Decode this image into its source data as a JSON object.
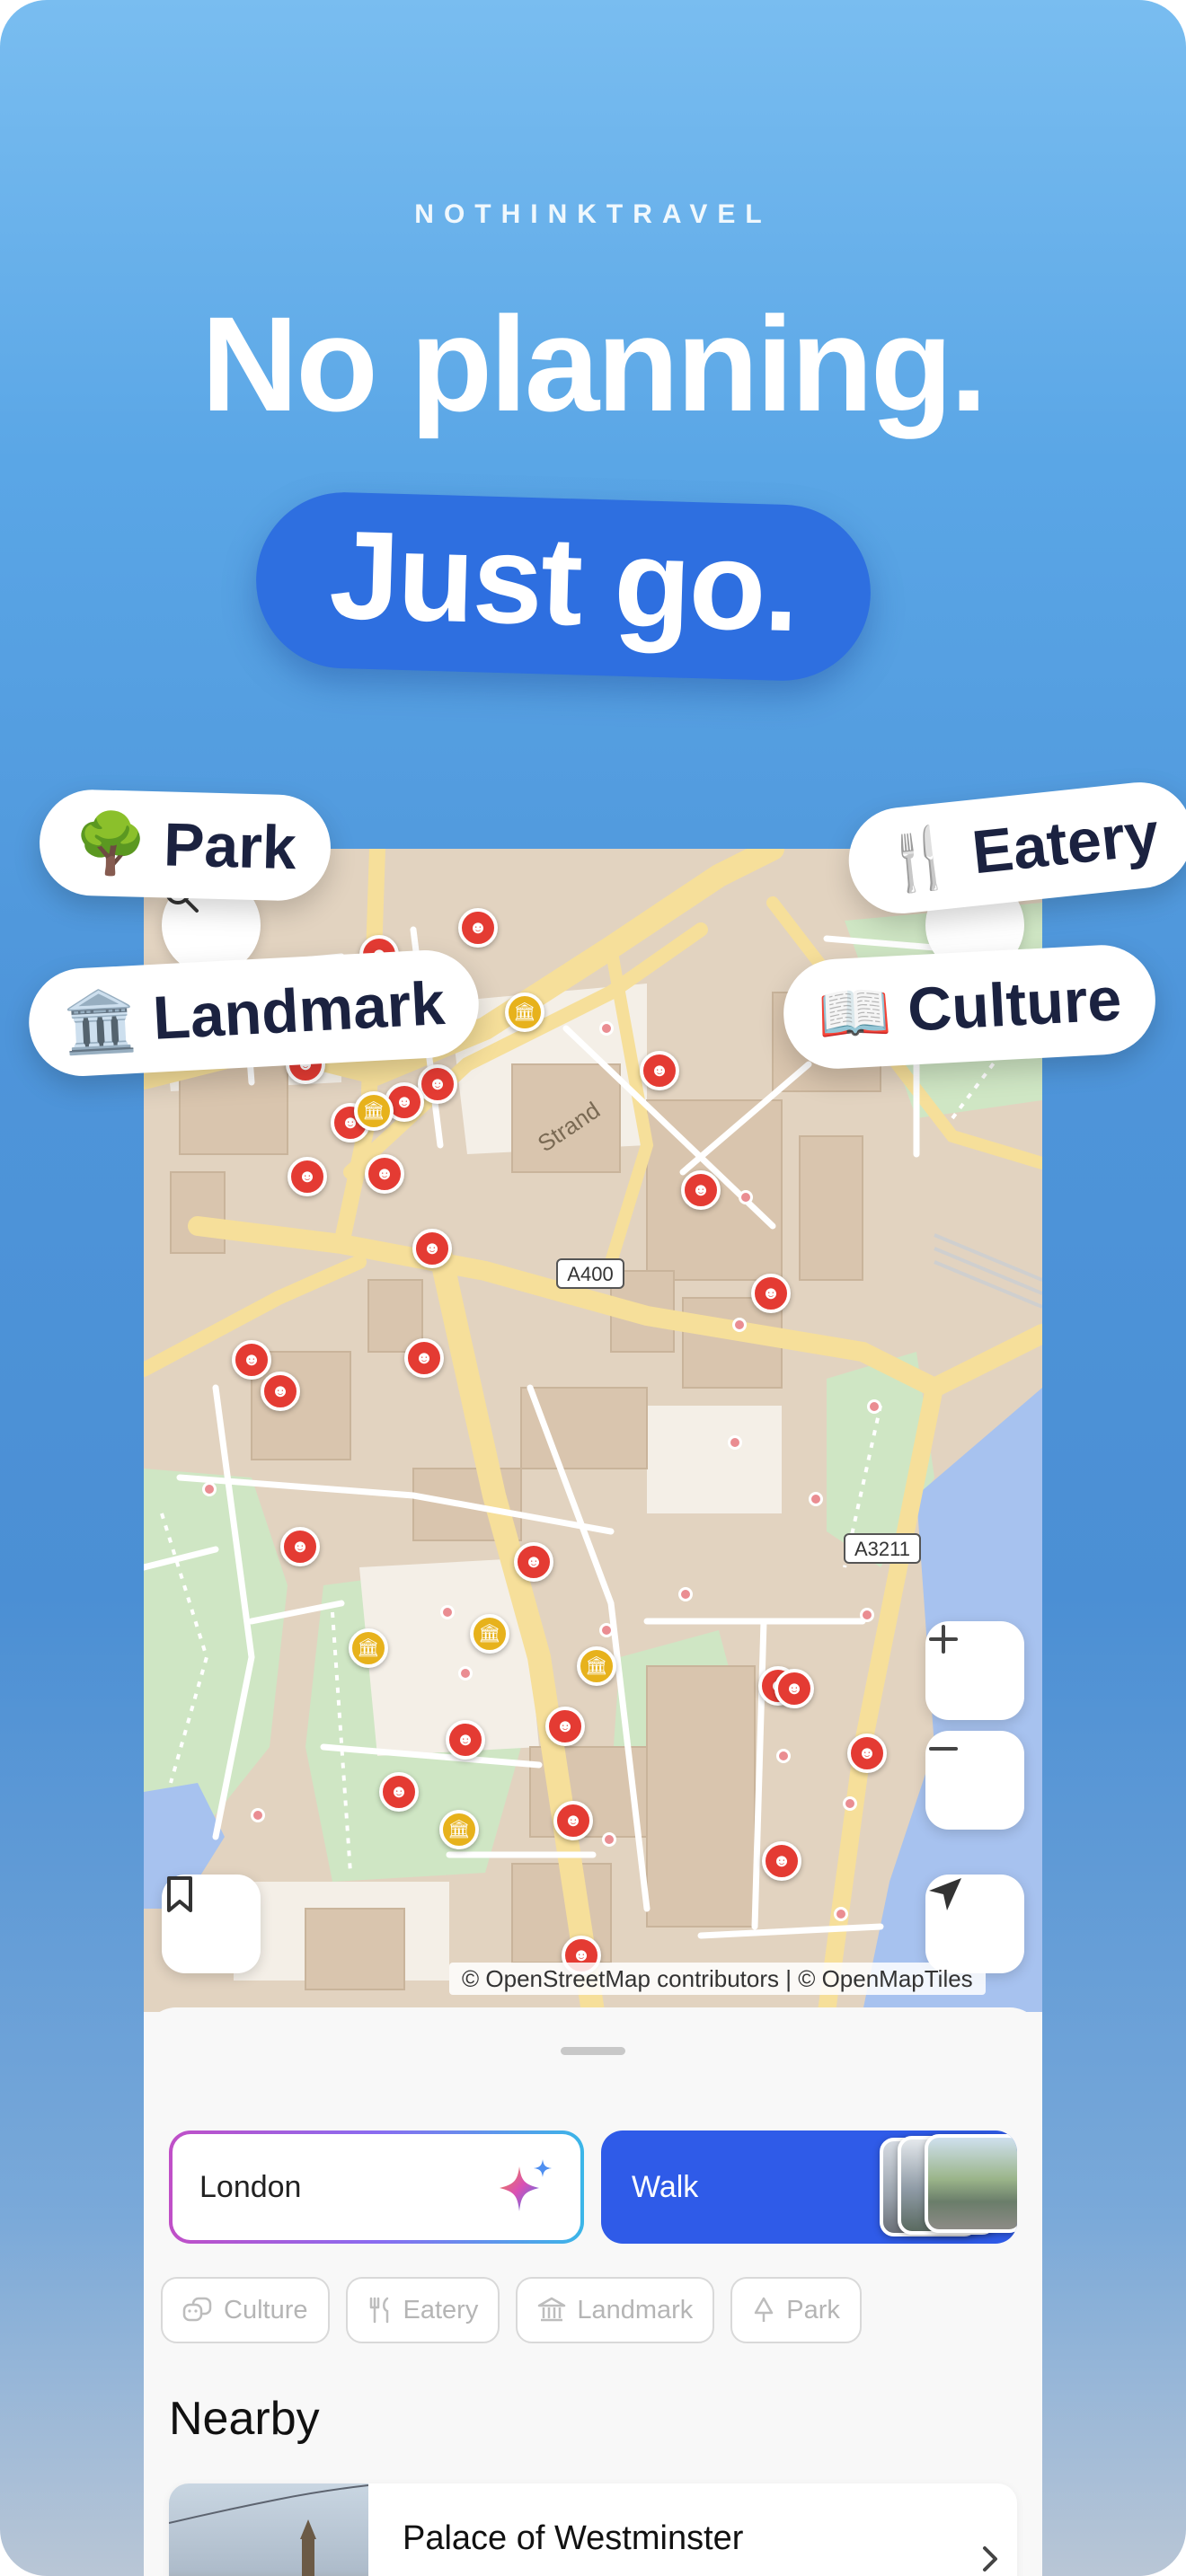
{
  "brand": "NOTHINKTRAVEL",
  "headline": "No planning.",
  "tagline": "Just go.",
  "category_pills": [
    {
      "emoji": "🌳",
      "label": "Park"
    },
    {
      "emoji": "🍴",
      "label": "Eatery"
    },
    {
      "emoji": "🏛️",
      "label": "Landmark"
    },
    {
      "emoji": "📖",
      "label": "Culture"
    }
  ],
  "map": {
    "street_label": "Strand",
    "road_badges": [
      "A400",
      "A3211"
    ],
    "attribution": "© OpenStreetMap contributors | © OpenMapTiles",
    "icons": {
      "search": "search-icon",
      "menu": "menu-icon",
      "zoom_in": "plus-icon",
      "zoom_out": "minus-icon",
      "locate": "navigation-arrow-icon",
      "bookmark": "bookmark-icon"
    }
  },
  "sheet": {
    "city_value": "London",
    "mode_label": "Walk",
    "filters": [
      {
        "icon": "theater-masks-icon",
        "label": "Culture"
      },
      {
        "icon": "fork-knife-icon",
        "label": "Eatery"
      },
      {
        "icon": "bank-icon",
        "label": "Landmark"
      },
      {
        "icon": "tree-icon",
        "label": "Park"
      }
    ],
    "nearby_title": "Nearby",
    "nearby_items": [
      {
        "title": "Palace of Westminster"
      }
    ]
  },
  "colors": {
    "accent_blue": "#2e6fe0",
    "walk_button": "#2f5be8",
    "culture_marker": "#e43b33",
    "landmark_marker": "#e7b21c"
  }
}
